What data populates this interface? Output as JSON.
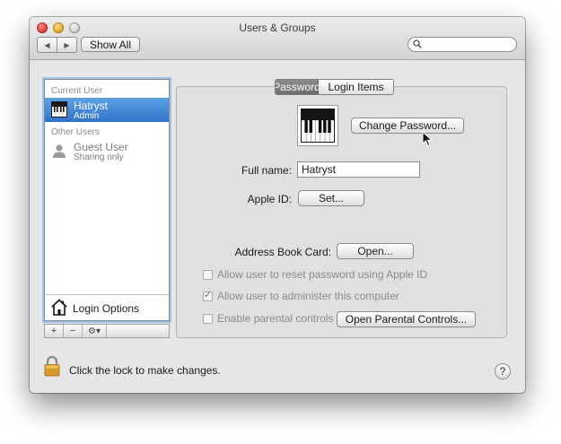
{
  "window": {
    "title": "Users & Groups"
  },
  "toolbar": {
    "back_glyph": "◀",
    "forward_glyph": "▶",
    "show_all_label": "Show All",
    "search": {
      "value": "",
      "icon": "search-icon"
    }
  },
  "sidebar": {
    "current_user_header": "Current User",
    "current_user": {
      "name": "Hatryst",
      "role": "Admin",
      "icon": "piano-avatar-icon"
    },
    "other_users_header": "Other Users",
    "other_users": [
      {
        "name": "Guest User",
        "role": "Sharing only",
        "icon": "person-icon"
      }
    ],
    "login_options_label": "Login Options",
    "add_glyph": "+",
    "remove_glyph": "−",
    "gear_glyph": "⚙▾"
  },
  "tabs": [
    {
      "label": "Password",
      "selected": true
    },
    {
      "label": "Login Items",
      "selected": false
    }
  ],
  "password_pane": {
    "change_password_label": "Change Password...",
    "full_name_label": "Full name:",
    "full_name_value": "Hatryst",
    "apple_id_label": "Apple ID:",
    "set_label": "Set...",
    "address_book_label": "Address Book Card:",
    "open_label": "Open...",
    "checkboxes": [
      {
        "label": "Allow user to reset password using Apple ID",
        "checked": false,
        "enabled": false
      },
      {
        "label": "Allow user to administer this computer",
        "checked": true,
        "enabled": false
      },
      {
        "label": "Enable parental controls",
        "checked": false,
        "enabled": false
      }
    ],
    "open_parental_controls_label": "Open Parental Controls...",
    "check_glyph": "✓"
  },
  "footer": {
    "lock_text": "Click the lock to make changes.",
    "help_glyph": "?"
  }
}
